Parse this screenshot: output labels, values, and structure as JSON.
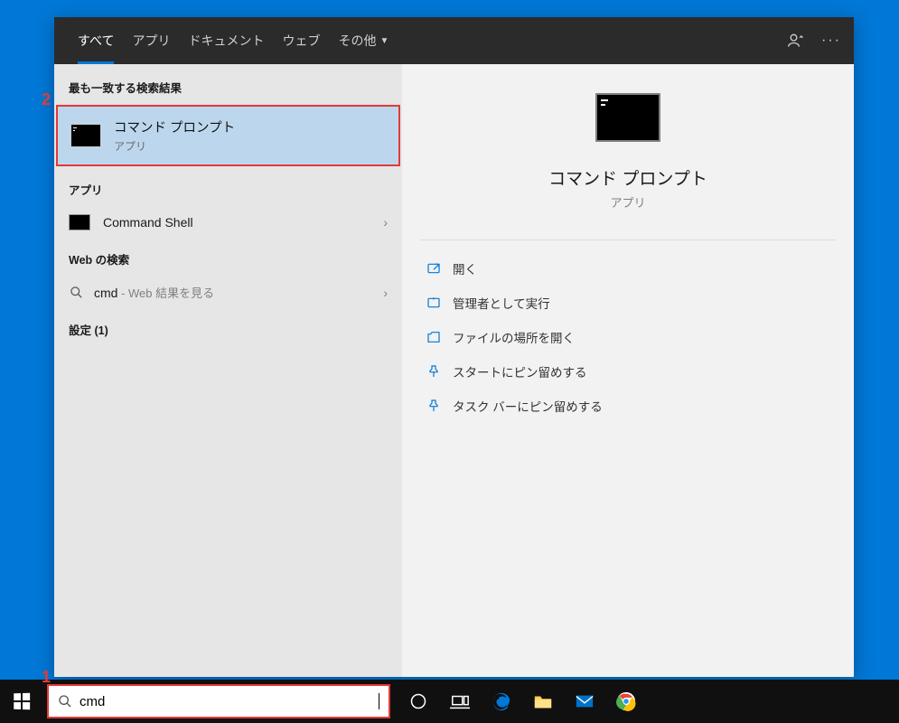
{
  "tabs": {
    "all": "すべて",
    "apps": "アプリ",
    "docs": "ドキュメント",
    "web": "ウェブ",
    "more": "その他"
  },
  "sections": {
    "bestmatch": "最も一致する検索結果",
    "apps": "アプリ",
    "websearch": "Web の検索",
    "settings": "設定 (1)"
  },
  "best": {
    "title": "コマンド プロンプト",
    "sub": "アプリ"
  },
  "appsList": [
    {
      "label": "Command Shell"
    }
  ],
  "web": {
    "query": "cmd",
    "hint": " - Web 結果を見る"
  },
  "detail": {
    "title": "コマンド プロンプト",
    "sub": "アプリ"
  },
  "actions": {
    "open": "開く",
    "admin": "管理者として実行",
    "loc": "ファイルの場所を開く",
    "pinstart": "スタートにピン留めする",
    "pintask": "タスク バーにピン留めする"
  },
  "search": {
    "value": "cmd"
  },
  "annot": {
    "one": "1",
    "two": "2"
  }
}
